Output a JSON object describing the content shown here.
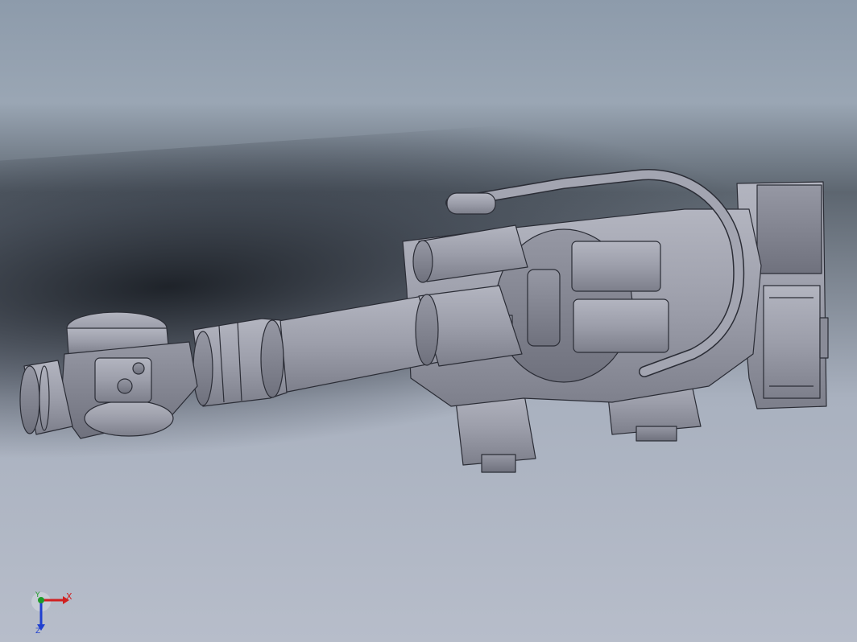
{
  "viewport": {
    "background_top": "#8d9bab",
    "background_bottom": "#b7bdca",
    "model_color": "#9a9ca8",
    "edge_color": "#2b2d36"
  },
  "triad": {
    "x_label": "X",
    "y_label": "Y",
    "z_label": "Z",
    "x_color": "#d02020",
    "y_color": "#1f9a2a",
    "z_color": "#1f3fd0"
  }
}
